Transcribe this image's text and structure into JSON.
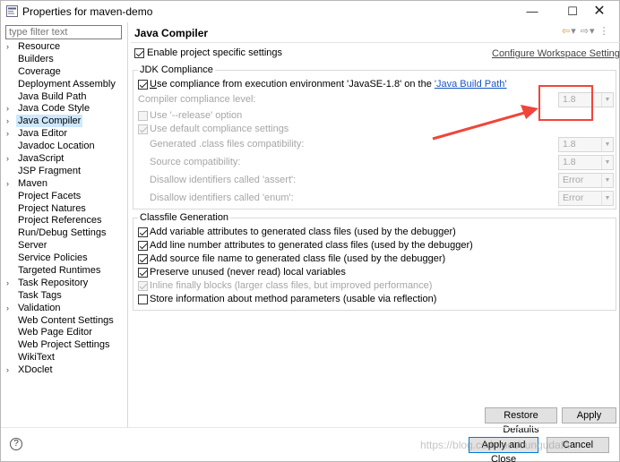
{
  "window": {
    "title": "Properties for maven-demo",
    "min_label": "—",
    "max_label": "☐",
    "close_label": "✕"
  },
  "left": {
    "filter_placeholder": "type filter text",
    "items": [
      {
        "label": "Resource",
        "expandable": true
      },
      {
        "label": "Builders",
        "expandable": false
      },
      {
        "label": "Coverage",
        "expandable": false
      },
      {
        "label": "Deployment Assembly",
        "expandable": false
      },
      {
        "label": "Java Build Path",
        "expandable": false
      },
      {
        "label": "Java Code Style",
        "expandable": true
      },
      {
        "label": "Java Compiler",
        "expandable": true,
        "selected": true
      },
      {
        "label": "Java Editor",
        "expandable": true
      },
      {
        "label": "Javadoc Location",
        "expandable": false
      },
      {
        "label": "JavaScript",
        "expandable": true
      },
      {
        "label": "JSP Fragment",
        "expandable": false
      },
      {
        "label": "Maven",
        "expandable": true
      },
      {
        "label": "Project Facets",
        "expandable": false
      },
      {
        "label": "Project Natures",
        "expandable": false
      },
      {
        "label": "Project References",
        "expandable": false
      },
      {
        "label": "Run/Debug Settings",
        "expandable": false
      },
      {
        "label": "Server",
        "expandable": false
      },
      {
        "label": "Service Policies",
        "expandable": false
      },
      {
        "label": "Targeted Runtimes",
        "expandable": false
      },
      {
        "label": "Task Repository",
        "expandable": true
      },
      {
        "label": "Task Tags",
        "expandable": false
      },
      {
        "label": "Validation",
        "expandable": true
      },
      {
        "label": "Web Content Settings",
        "expandable": false
      },
      {
        "label": "Web Page Editor",
        "expandable": false
      },
      {
        "label": "Web Project Settings",
        "expandable": false
      },
      {
        "label": "WikiText",
        "expandable": false
      },
      {
        "label": "XDoclet",
        "expandable": true
      }
    ]
  },
  "page": {
    "title": "Java Compiler",
    "nav_icons": "⇦ ▾ ⇨ ▾ ⋮",
    "enable_specific": "Enable project specific settings",
    "configure_link": "Configure Workspace Settings...",
    "jdk": {
      "group_title": "JDK Compliance",
      "use_compliance_prefix": "se compliance from execution environment 'JavaSE-1.8' on the ",
      "use_compliance_mnemonic": "U",
      "build_path_link": "'Java Build Path'",
      "compliance_level_label": "Compiler compliance level:",
      "compliance_level_value": "1.8",
      "release_option": "Use '--release' option",
      "default_settings": "Use default compliance settings",
      "generated_label": "Generated .class files compatibility:",
      "generated_value": "1.8",
      "source_label": "Source compatibility:",
      "source_value": "1.8",
      "assert_label": "Disallow identifiers called 'assert':",
      "assert_value": "Error",
      "enum_label": "Disallow identifiers called 'enum':",
      "enum_value": "Error"
    },
    "classfile": {
      "group_title": "Classfile Generation",
      "options": [
        {
          "label": "Add variable attributes to generated class files (used by the debugger)",
          "checked": true,
          "enabled": true
        },
        {
          "label": "Add line number attributes to generated class files (used by the debugger)",
          "checked": true,
          "enabled": true
        },
        {
          "label": "Add source file name to generated class file (used by the debugger)",
          "checked": true,
          "enabled": true
        },
        {
          "label": "Preserve unused (never read) local variables",
          "checked": true,
          "enabled": true
        },
        {
          "label": "Inline finally blocks (larger class files, but improved performance)",
          "checked": true,
          "enabled": false
        },
        {
          "label": "Store information about method parameters (usable via reflection)",
          "checked": false,
          "enabled": true
        }
      ]
    },
    "restore_defaults": "Restore Defaults",
    "apply": "Apply"
  },
  "footer": {
    "help": "?",
    "apply_and_close": "Apply and Close",
    "cancel": "Cancel",
    "watermark": "https://blog.csdn.net/cungudafa"
  },
  "colors": {
    "selection": "#cde8ff",
    "annotation_red": "#f0453a",
    "link_blue": "#1a55c4"
  }
}
